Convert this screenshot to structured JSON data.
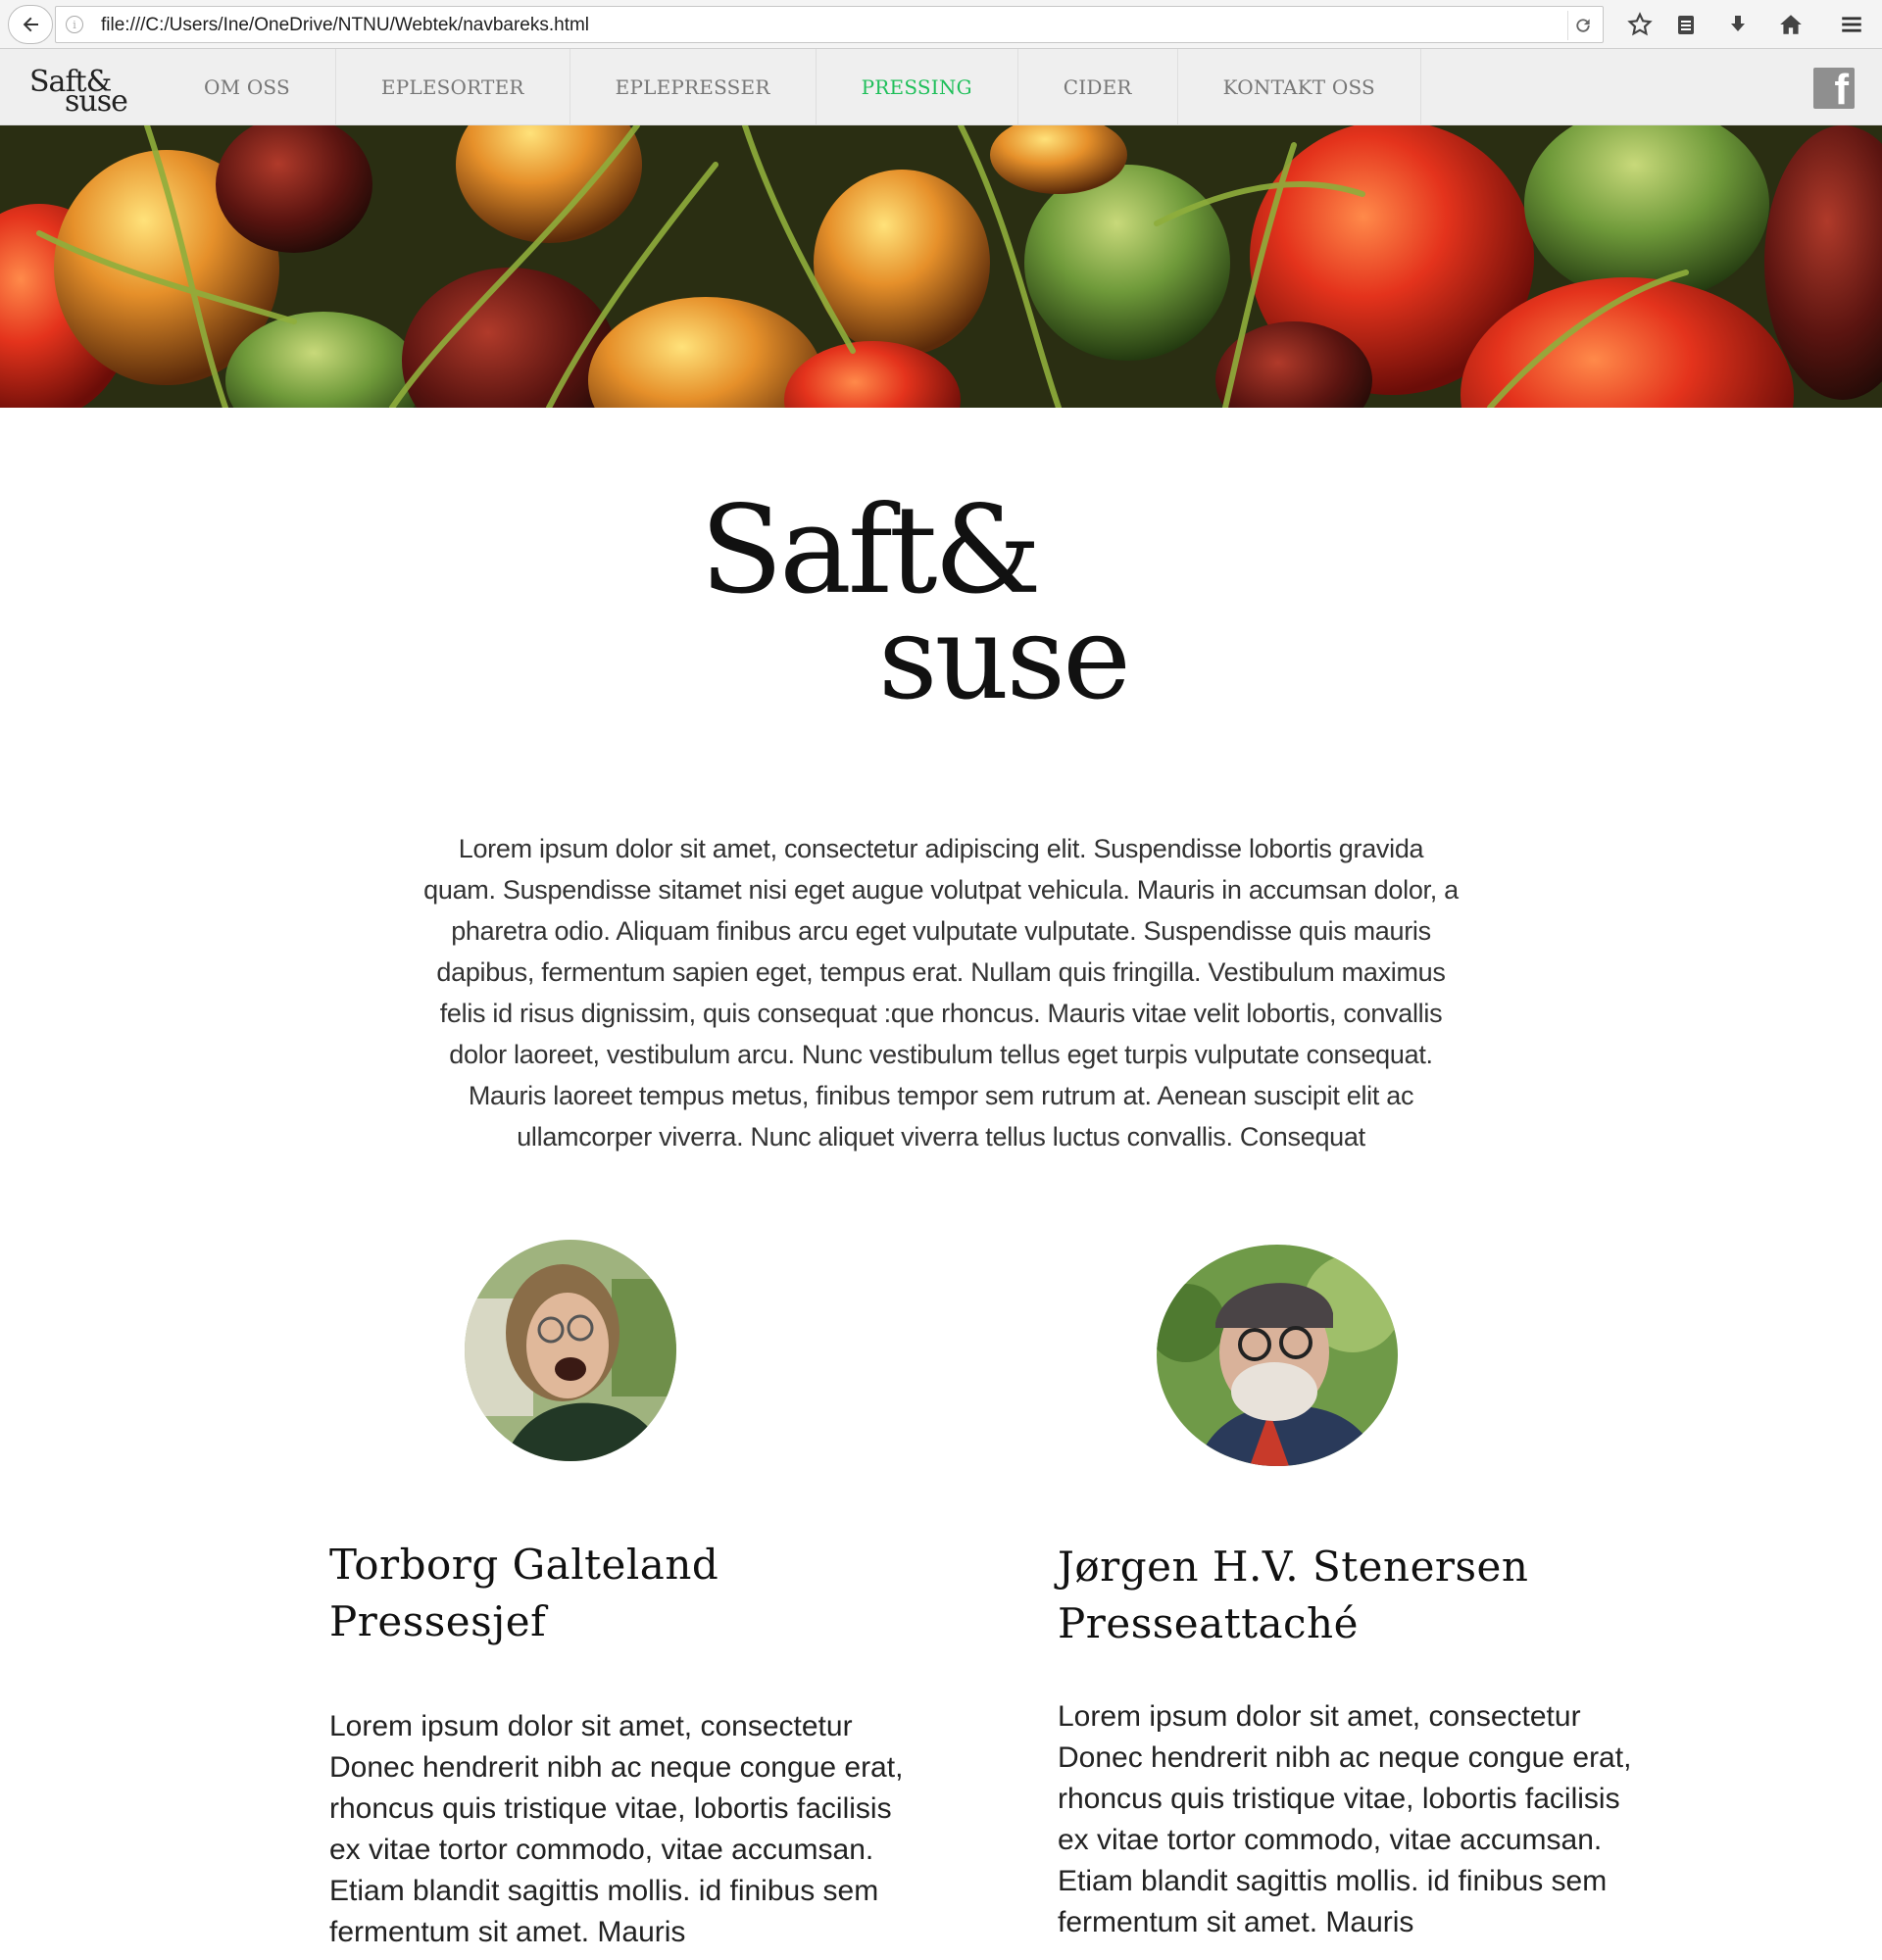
{
  "browser": {
    "url": "file:///C:/Users/Ine/OneDrive/NTNU/Webtek/navbareks.html",
    "info_icon": "i"
  },
  "nav": {
    "logo_line1": "Saft&",
    "logo_line2": "suse",
    "items": [
      {
        "label": "OM OSS"
      },
      {
        "label": "EPLESORTER"
      },
      {
        "label": "EPLEPRESSER"
      },
      {
        "label": "PRESSING",
        "active": true
      },
      {
        "label": "CIDER"
      },
      {
        "label": "KONTAKT OSS"
      }
    ],
    "active_color": "#1fbf5a",
    "facebook_glyph": "f"
  },
  "hero": {
    "description": "apples-in-grass-banner"
  },
  "logo": {
    "line1": "Saft&",
    "line2": "suse"
  },
  "intro": {
    "text": "Lorem ipsum dolor sit amet, consectetur adipiscing elit. Suspendisse lobortis gravida quam. Suspendisse sitamet nisi eget augue volutpat vehicula. Mauris in accumsan dolor, a pharetra odio. Aliquam finibus arcu eget vulputate vulputate. Suspendisse quis mauris dapibus, fermentum sapien eget, tempus erat. Nullam quis fringilla. Vestibulum maximus felis id risus dignissim, quis consequat :que rhoncus. Mauris vitae velit lobortis, convallis dolor laoreet, vestibulum arcu. Nunc vestibulum tellus eget turpis vulputate consequat. Mauris laoreet tempus metus, finibus tempor sem rutrum at. Aenean suscipit elit ac ullamcorper viverra. Nunc aliquet viverra tellus luctus convallis. Consequat"
  },
  "people": [
    {
      "name": "Torborg Galteland",
      "title": "Pressesjef",
      "bio": "Lorem ipsum dolor sit amet, consectetur Donec hendrerit nibh ac neque congue erat, rhoncus quis tristique vitae, lobortis facilisis ex vitae tortor commodo, vitae accumsan. Etiam blandit sagittis mollis. id finibus sem fermentum sit amet. Mauris"
    },
    {
      "name": "Jørgen H.V. Stenersen",
      "title": "Presseattaché",
      "bio": "Lorem ipsum dolor sit amet, consectetur Donec hendrerit nibh ac neque congue erat, rhoncus quis tristique vitae, lobortis facilisis ex vitae tortor commodo, vitae accumsan. Etiam blandit sagittis mollis. id finibus sem fermentum sit amet. Mauris"
    }
  ]
}
